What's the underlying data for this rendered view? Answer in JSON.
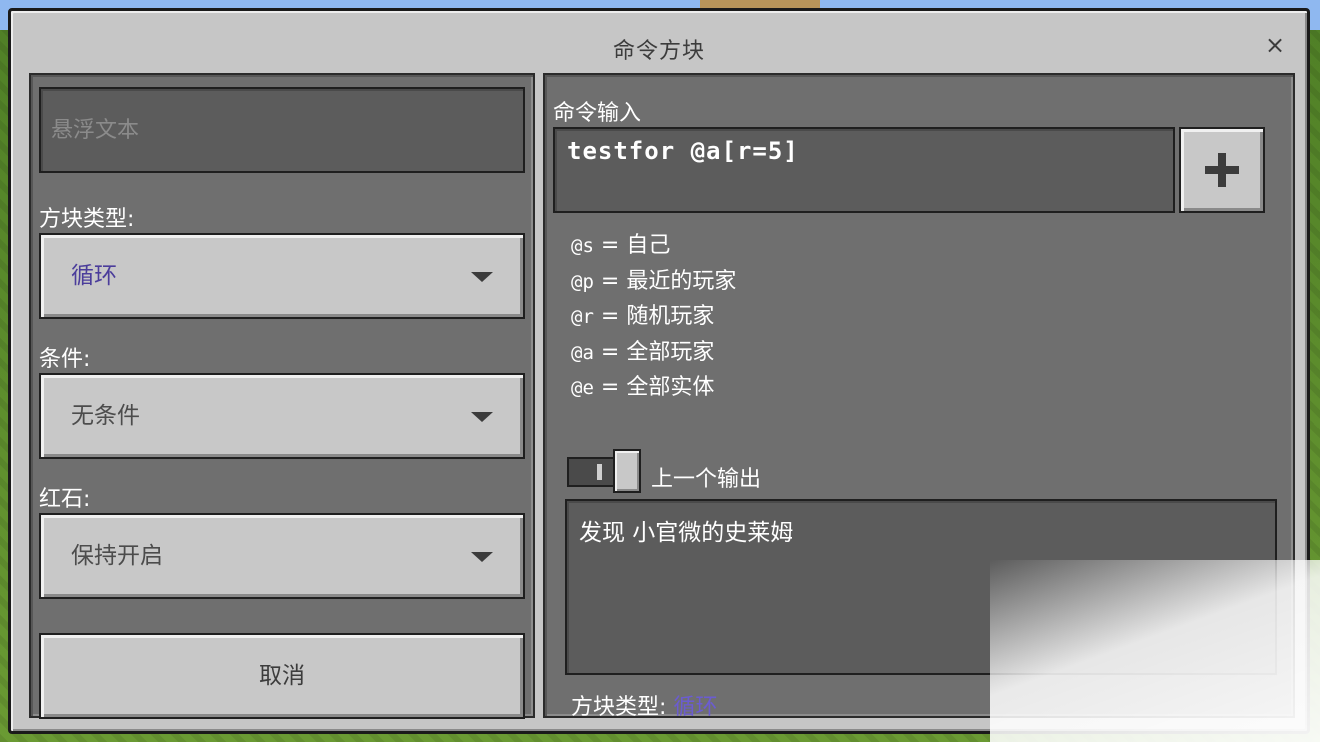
{
  "window": {
    "title": "命令方块",
    "close_glyph": "×"
  },
  "left": {
    "hover_text_placeholder": "悬浮文本",
    "block_type_label": "方块类型:",
    "block_type_value": "循环",
    "condition_label": "条件:",
    "condition_value": "无条件",
    "redstone_label": "红石:",
    "redstone_value": "保持开启",
    "cancel_label": "取消"
  },
  "right": {
    "command_input_label": "命令输入",
    "command_value": "testfor @a[r=5]",
    "selectors": [
      {
        "code": "@s",
        "eq": " = ",
        "desc": "自己"
      },
      {
        "code": "@p",
        "eq": " = ",
        "desc": "最近的玩家"
      },
      {
        "code": "@r",
        "eq": " = ",
        "desc": "随机玩家"
      },
      {
        "code": "@a",
        "eq": " = ",
        "desc": "全部玩家"
      },
      {
        "code": "@e",
        "eq": " = ",
        "desc": "全部实体"
      }
    ],
    "previous_output_label": "上一个输出",
    "previous_output_toggle": false,
    "output_text": "发现 小官微的史莱姆",
    "block_type_label": "方块类型:",
    "block_type_value": "循环"
  },
  "colors": {
    "accent_purple": "#4b3d9b",
    "panel_gray": "#6f6f6f",
    "window_gray": "#c6c6c6"
  },
  "icons": {
    "close": "close-icon",
    "dropdown": "chevron-down-icon",
    "add": "plus-icon"
  }
}
